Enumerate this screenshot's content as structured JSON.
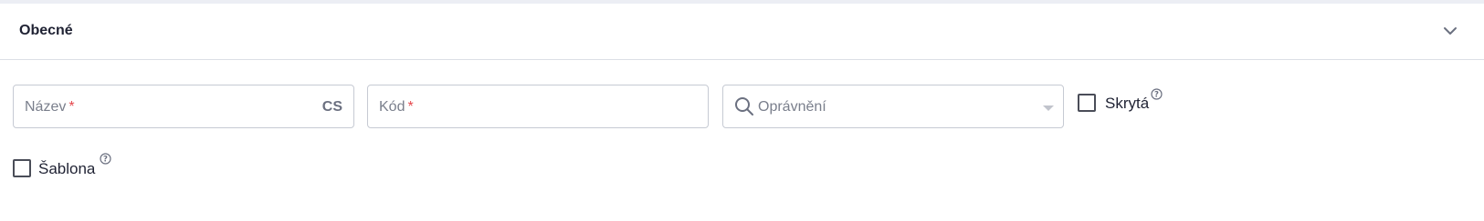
{
  "section": {
    "title": "Obecné",
    "collapse_icon": "chevron-down-icon"
  },
  "fields": {
    "name": {
      "label": "Název",
      "required_mark": "*",
      "lang": "CS"
    },
    "code": {
      "label": "Kód",
      "required_mark": "*"
    },
    "permission": {
      "placeholder": "Oprávnění",
      "icon": "search-icon",
      "dropdown_icon": "caret-down-icon"
    }
  },
  "checkboxes": {
    "hidden": {
      "label": "Skrytá",
      "checked": false,
      "help_icon": "question-circle-icon"
    },
    "template": {
      "label": "Šablona",
      "checked": false,
      "help_icon": "question-circle-icon"
    }
  },
  "colors": {
    "required": "#e5484d",
    "border": "#c6cad3",
    "top_strip": "#eceef4"
  }
}
